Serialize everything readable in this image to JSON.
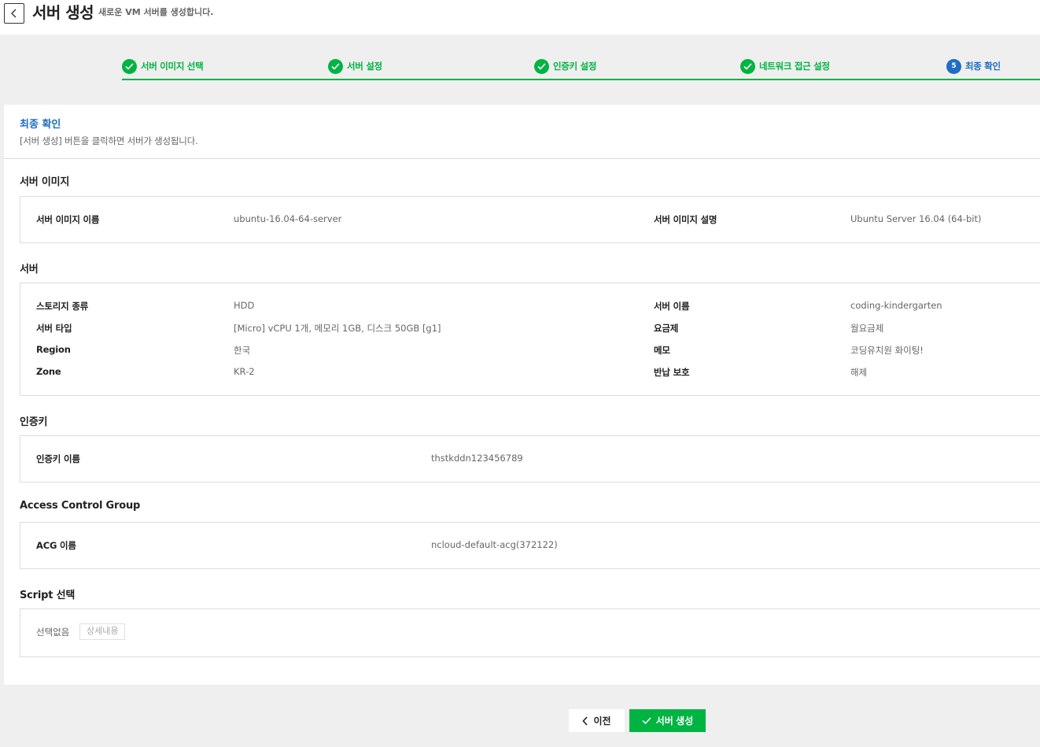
{
  "header": {
    "title": "서버 생성",
    "subtitle": "새로운 VM 서버를 생성합니다."
  },
  "steps": [
    {
      "label": "서버 이미지 선택",
      "status": "done"
    },
    {
      "label": "서버 설정",
      "status": "done"
    },
    {
      "label": "인증키 설정",
      "status": "done"
    },
    {
      "label": "네트워크 접근 설정",
      "status": "done"
    },
    {
      "label": "최종 확인",
      "status": "active",
      "number": "5"
    }
  ],
  "final": {
    "title": "최종 확인",
    "description": "[서버 생성] 버튼을 클릭하면 서버가 생성됩니다."
  },
  "server_image": {
    "title": "서버 이미지",
    "name_label": "서버 이미지 이름",
    "name_value": "ubuntu-16.04-64-server",
    "desc_label": "서버 이미지 설명",
    "desc_value": "Ubuntu Server 16.04 (64-bit)"
  },
  "server": {
    "title": "서버",
    "storage_label": "스토리지 종류",
    "storage_value": "HDD",
    "type_label": "서버 타입",
    "type_value": "[Micro] vCPU 1개, 메모리 1GB, 디스크 50GB [g1]",
    "region_label": "Region",
    "region_value": "한국",
    "zone_label": "Zone",
    "zone_value": "KR-2",
    "name_label": "서버 이름",
    "name_value": "coding-kindergarten",
    "billing_label": "요금제",
    "billing_value": "월요금제",
    "memo_label": "메모",
    "memo_value": "코딩유치원 화이팅!",
    "protect_label": "반납 보호",
    "protect_value": "해제"
  },
  "auth_key": {
    "title": "인증키",
    "name_label": "인증키 이름",
    "name_value": "thstkddn123456789"
  },
  "acg": {
    "title": "Access Control Group",
    "name_label": "ACG 이름",
    "name_value": "ncloud-default-acg(372122)"
  },
  "script": {
    "title": "Script 선택",
    "value": "선택없음",
    "detail_button": "상세내용"
  },
  "footer": {
    "prev_label": "이전",
    "create_label": "서버 생성"
  },
  "colors": {
    "accent_green": "#00b442",
    "accent_blue": "#1f6dc4"
  }
}
